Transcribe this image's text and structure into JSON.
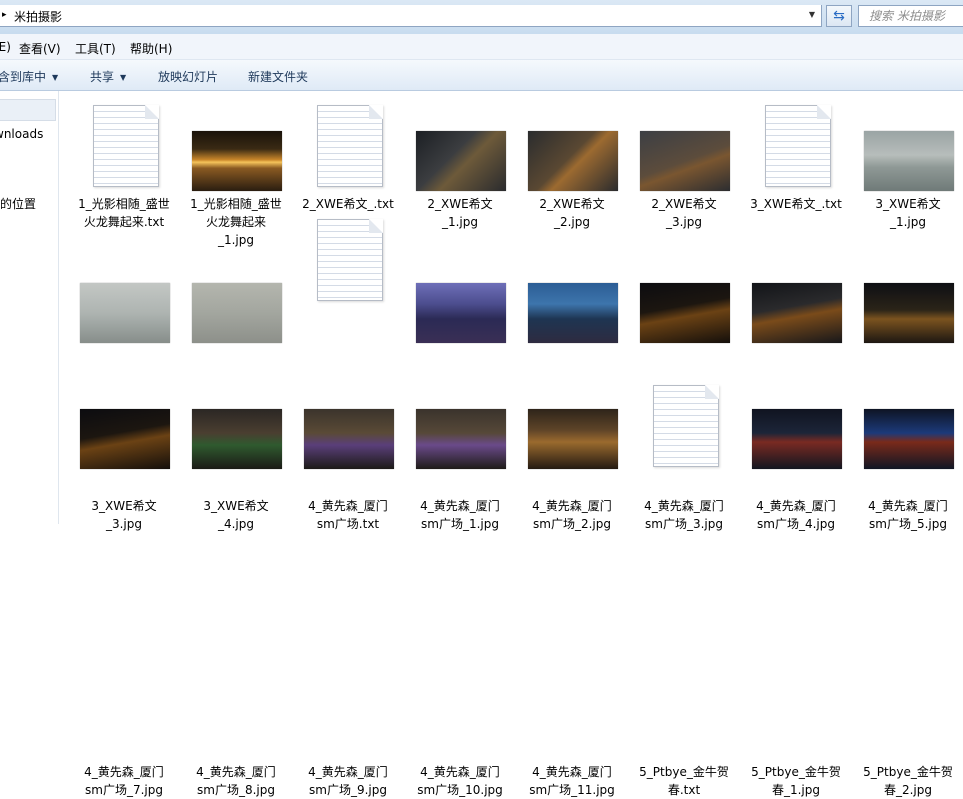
{
  "window": {
    "breadcrumb": "米拍摄影",
    "search_placeholder": "搜索 米拍摄影"
  },
  "menu": [
    "(E)",
    "查看(V)",
    "工具(T)",
    "帮助(H)"
  ],
  "commands": [
    {
      "label": "含到库中",
      "dropdown": true
    },
    {
      "label": "共享",
      "dropdown": true
    },
    {
      "label": "放映幻灯片",
      "dropdown": false
    },
    {
      "label": "新建文件夹",
      "dropdown": false
    }
  ],
  "nav": [
    "wnloads",
    "的位置"
  ],
  "files": [
    {
      "name": "1_光影相随_盛世\n火龙舞起来.txt",
      "kind": "txt"
    },
    {
      "name": "1_光影相随_盛世\n火龙舞起来\n_1.jpg",
      "kind": "fire"
    },
    {
      "name": "2_XWE希文_.txt",
      "kind": "txt"
    },
    {
      "name": "2_XWE希文\n_1.jpg",
      "kind": "sparks"
    },
    {
      "name": "2_XWE希文\n_2.jpg",
      "kind": "sparks2"
    },
    {
      "name": "2_XWE希文\n_3.jpg",
      "kind": "sparks3"
    },
    {
      "name": "3_XWE希文_.txt",
      "kind": "txt"
    },
    {
      "name": "3_XWE希文\n_1.jpg",
      "kind": "sea"
    },
    {
      "name": "3_XWE希文\n_3.jpg",
      "kind": "fog"
    },
    {
      "name": "3_XWE希文\n_4.jpg",
      "kind": "fog2"
    },
    {
      "name": "4_黄先森_厦门\nsm广场.txt",
      "kind": "txt"
    },
    {
      "name": "4_黄先森_厦门\nsm广场_1.jpg",
      "kind": "dusk"
    },
    {
      "name": "4_黄先森_厦门\nsm广场_2.jpg",
      "kind": "dusk2"
    },
    {
      "name": "4_黄先森_厦门\nsm广场_3.jpg",
      "kind": "night"
    },
    {
      "name": "4_黄先森_厦门\nsm广场_4.jpg",
      "kind": "night2"
    },
    {
      "name": "4_黄先森_厦门\nsm广场_5.jpg",
      "kind": "night3"
    },
    {
      "name": "4_黄先森_厦门\nsm广场_7.jpg",
      "kind": "night"
    },
    {
      "name": "4_黄先森_厦门\nsm广场_8.jpg",
      "kind": "park"
    },
    {
      "name": "4_黄先森_厦门\nsm广场_9.jpg",
      "kind": "park2"
    },
    {
      "name": "4_黄先森_厦门\nsm广场_10.jpg",
      "kind": "park3"
    },
    {
      "name": "4_黄先森_厦门\nsm广场_11.jpg",
      "kind": "city"
    },
    {
      "name": "5_Ptbye_金牛贺\n春.txt",
      "kind": "txt"
    },
    {
      "name": "5_Ptbye_金牛贺\n春_1.jpg",
      "kind": "tower"
    },
    {
      "name": "5_Ptbye_金牛贺\n春_2.jpg",
      "kind": "tower2"
    }
  ]
}
